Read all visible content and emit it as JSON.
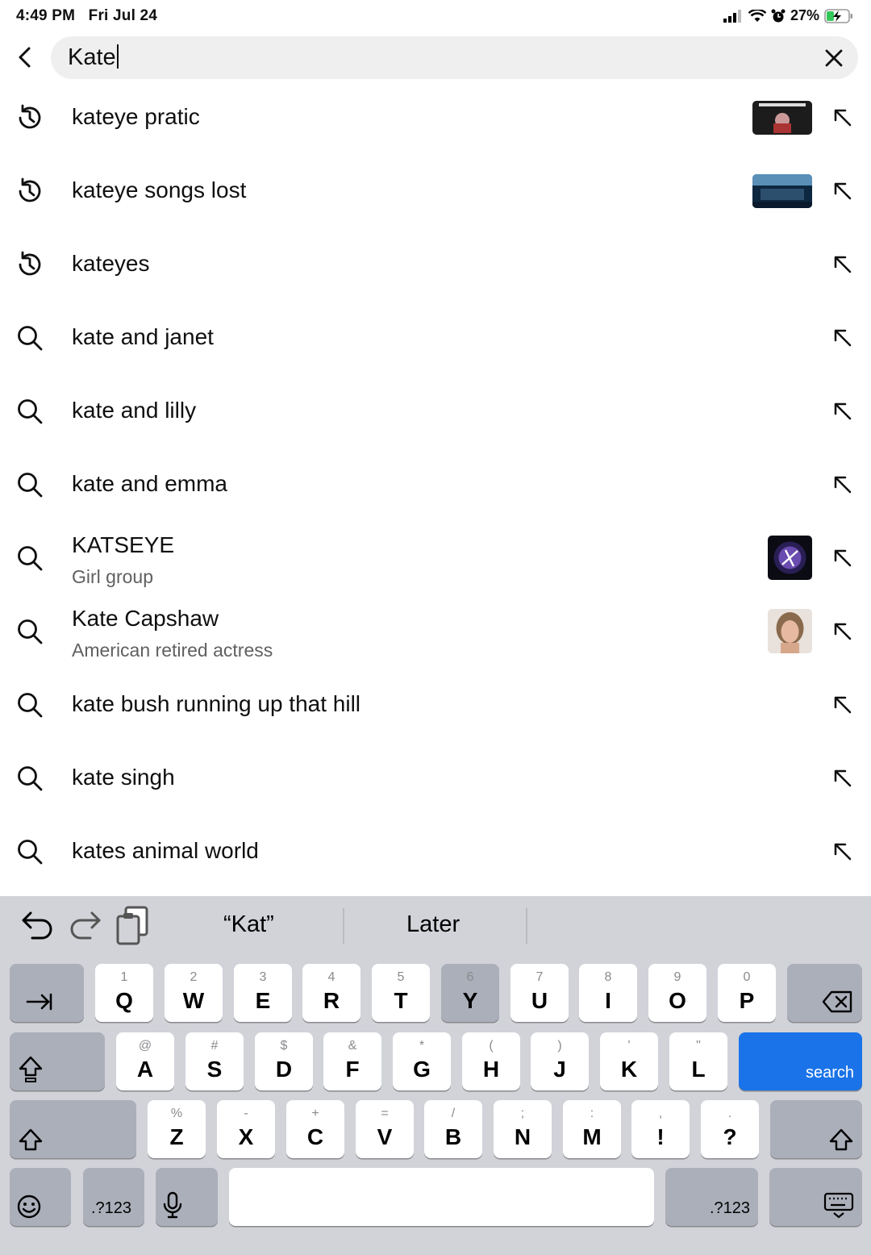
{
  "status": {
    "time": "4:49 PM",
    "date": "Fri Jul 24",
    "battery": "27%"
  },
  "search": {
    "query": "Kate"
  },
  "suggestions": [
    {
      "icon": "history-icon",
      "text": "kateye pratic",
      "subtitle": "",
      "thumb": "video"
    },
    {
      "icon": "history-icon",
      "text": "kateye songs lost",
      "subtitle": "",
      "thumb": "video2"
    },
    {
      "icon": "history-icon",
      "text": "kateyes",
      "subtitle": "",
      "thumb": ""
    },
    {
      "icon": "search-icon",
      "text": "kate and janet",
      "subtitle": "",
      "thumb": ""
    },
    {
      "icon": "search-icon",
      "text": "kate and lilly",
      "subtitle": "",
      "thumb": ""
    },
    {
      "icon": "search-icon",
      "text": "kate and emma",
      "subtitle": "",
      "thumb": ""
    },
    {
      "icon": "search-icon",
      "text": "KATSEYE",
      "subtitle": "Girl group",
      "thumb": "logo"
    },
    {
      "icon": "search-icon",
      "text": "Kate Capshaw",
      "subtitle": "American retired actress",
      "thumb": "portrait"
    },
    {
      "icon": "search-icon",
      "text": "kate bush running up that hill",
      "subtitle": "",
      "thumb": ""
    },
    {
      "icon": "search-icon",
      "text": "kate singh",
      "subtitle": "",
      "thumb": ""
    },
    {
      "icon": "search-icon",
      "text": "kates animal world",
      "subtitle": "",
      "thumb": ""
    }
  ],
  "keyboard": {
    "suggestions": [
      "“Kat”",
      "Later"
    ],
    "row1": [
      {
        "main": "Q",
        "alt": "1"
      },
      {
        "main": "W",
        "alt": "2"
      },
      {
        "main": "E",
        "alt": "3"
      },
      {
        "main": "R",
        "alt": "4"
      },
      {
        "main": "T",
        "alt": "5"
      },
      {
        "main": "Y",
        "alt": "6"
      },
      {
        "main": "U",
        "alt": "7"
      },
      {
        "main": "I",
        "alt": "8"
      },
      {
        "main": "O",
        "alt": "9"
      },
      {
        "main": "P",
        "alt": "0"
      }
    ],
    "row2": [
      {
        "main": "A",
        "alt": "@"
      },
      {
        "main": "S",
        "alt": "#"
      },
      {
        "main": "D",
        "alt": "$"
      },
      {
        "main": "F",
        "alt": "&"
      },
      {
        "main": "G",
        "alt": "*"
      },
      {
        "main": "H",
        "alt": "("
      },
      {
        "main": "J",
        "alt": ")"
      },
      {
        "main": "K",
        "alt": "'"
      },
      {
        "main": "L",
        "alt": "\""
      }
    ],
    "row3": [
      {
        "main": "Z",
        "alt": "%"
      },
      {
        "main": "X",
        "alt": "-"
      },
      {
        "main": "C",
        "alt": "+"
      },
      {
        "main": "V",
        "alt": "="
      },
      {
        "main": "B",
        "alt": "/"
      },
      {
        "main": "N",
        "alt": ";"
      },
      {
        "main": "M",
        "alt": ":"
      },
      {
        "main": "!",
        "alt": ","
      },
      {
        "main": "?",
        "alt": "."
      }
    ],
    "search_label": "search",
    "numbers_label": ".?123",
    "accent_color": "#1a73e8"
  }
}
